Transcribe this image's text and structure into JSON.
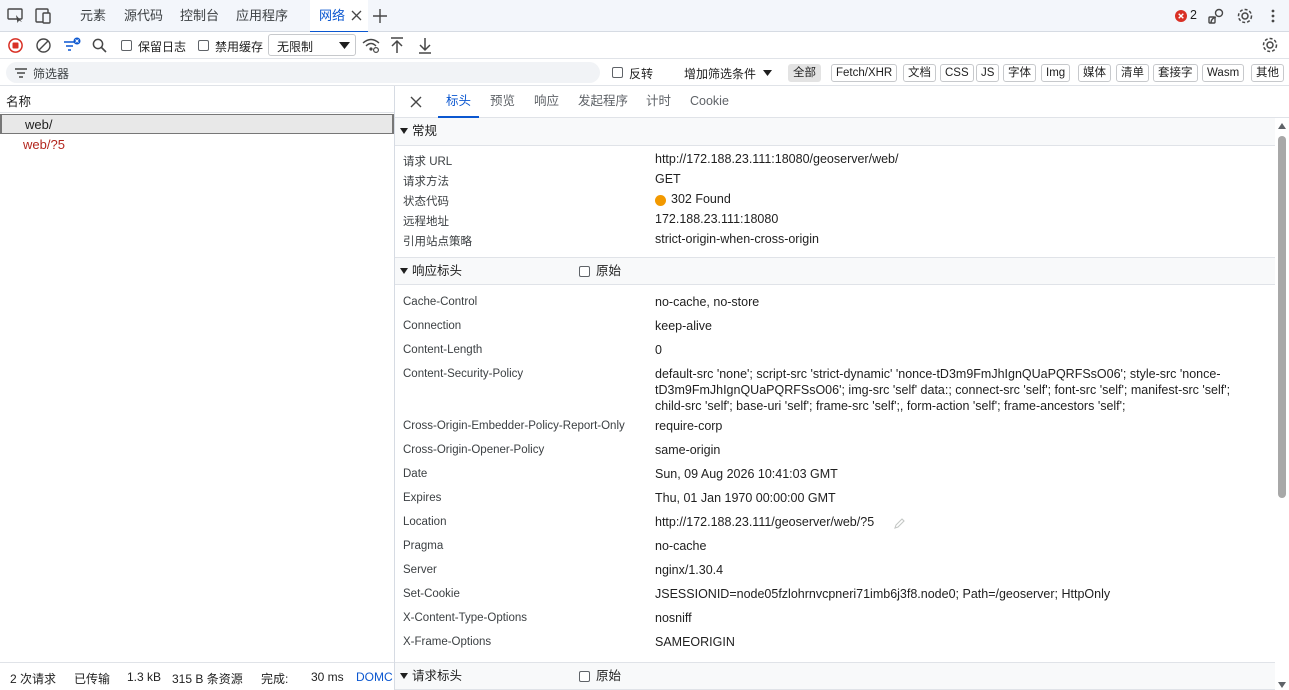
{
  "devtools": {
    "tabs": [
      "元素",
      "源代码",
      "控制台",
      "应用程序",
      "网络"
    ],
    "active_tab": "网络",
    "error_count": "2"
  },
  "toolbar": {
    "preserve_log_label": "保留日志",
    "disable_cache_label": "禁用缓存",
    "throttle_value": "无限制"
  },
  "filter": {
    "placeholder": "筛选器",
    "invert_label": "反转",
    "more_filters_label": "增加筛选条件",
    "types": [
      "全部",
      "Fetch/XHR",
      "文档",
      "CSS",
      "JS",
      "字体",
      "Img",
      "媒体",
      "清单",
      "套接字",
      "Wasm",
      "其他"
    ],
    "selected_type": "全部"
  },
  "requests": {
    "column_header": "名称",
    "rows": [
      {
        "name": "web/",
        "color": "#1f1f1f",
        "selected": true
      },
      {
        "name": "web/?5",
        "color": "#b3261e",
        "selected": false
      }
    ]
  },
  "statusbar": {
    "requests": "2 次请求",
    "transferred": "已传输",
    "transferred_size": "1.3 kB",
    "resources": "315 B 条资源",
    "finish_label": "完成:",
    "finish_time": "30 ms",
    "domcontent": "DOMC"
  },
  "details": {
    "tabs": [
      "标头",
      "预览",
      "响应",
      "发起程序",
      "计时",
      "Cookie"
    ],
    "active_tab": "标头",
    "general": {
      "title": "常规",
      "rows": [
        {
          "key": "请求 URL",
          "value": "http://172.188.23.111:18080/geoserver/web/"
        },
        {
          "key": "请求方法",
          "value": "GET"
        },
        {
          "key": "状态代码",
          "value": "302 Found"
        },
        {
          "key": "远程地址",
          "value": "172.188.23.111:18080"
        },
        {
          "key": "引用站点策略",
          "value": "strict-origin-when-cross-origin"
        }
      ],
      "status_dot_color": "#f29900"
    },
    "response_headers": {
      "title": "响应标头",
      "raw_label": "原始",
      "rows": [
        {
          "key": "Cache-Control",
          "value": "no-cache, no-store"
        },
        {
          "key": "Connection",
          "value": "keep-alive"
        },
        {
          "key": "Content-Length",
          "value": "0"
        },
        {
          "key": "Content-Security-Policy",
          "value": "default-src 'none'; script-src 'strict-dynamic' 'nonce-tD3m9FmJhIgnQUaPQRFSsO06'; style-src 'nonce-tD3m9FmJhIgnQUaPQRFSsO06'; img-src 'self' data:; connect-src 'self'; font-src 'self'; manifest-src 'self'; child-src 'self'; base-uri 'self'; frame-src 'self';, form-action 'self'; frame-ancestors 'self';"
        },
        {
          "key": "Cross-Origin-Embedder-Policy-Report-Only",
          "value": "require-corp"
        },
        {
          "key": "Cross-Origin-Opener-Policy",
          "value": "same-origin"
        },
        {
          "key": "Date",
          "value": "Sun, 09 Aug 2026 10:41:03 GMT"
        },
        {
          "key": "Expires",
          "value": "Thu, 01 Jan 1970 00:00:00 GMT"
        },
        {
          "key": "Location",
          "value": "http://172.188.23.111/geoserver/web/?5"
        },
        {
          "key": "Pragma",
          "value": "no-cache"
        },
        {
          "key": "Server",
          "value": "nginx/1.30.4"
        },
        {
          "key": "Set-Cookie",
          "value": "JSESSIONID=node05fzlohrnvcpneri71imb6j3f8.node0; Path=/geoserver; HttpOnly"
        },
        {
          "key": "X-Content-Type-Options",
          "value": "nosniff"
        },
        {
          "key": "X-Frame-Options",
          "value": "SAMEORIGIN"
        }
      ]
    },
    "request_headers": {
      "title": "请求标头",
      "raw_label": "原始"
    }
  },
  "colors": {
    "accent": "#0b57d0",
    "record": "#d93025",
    "error_badge": "#d93025",
    "redirect_text": "#b3261e"
  }
}
